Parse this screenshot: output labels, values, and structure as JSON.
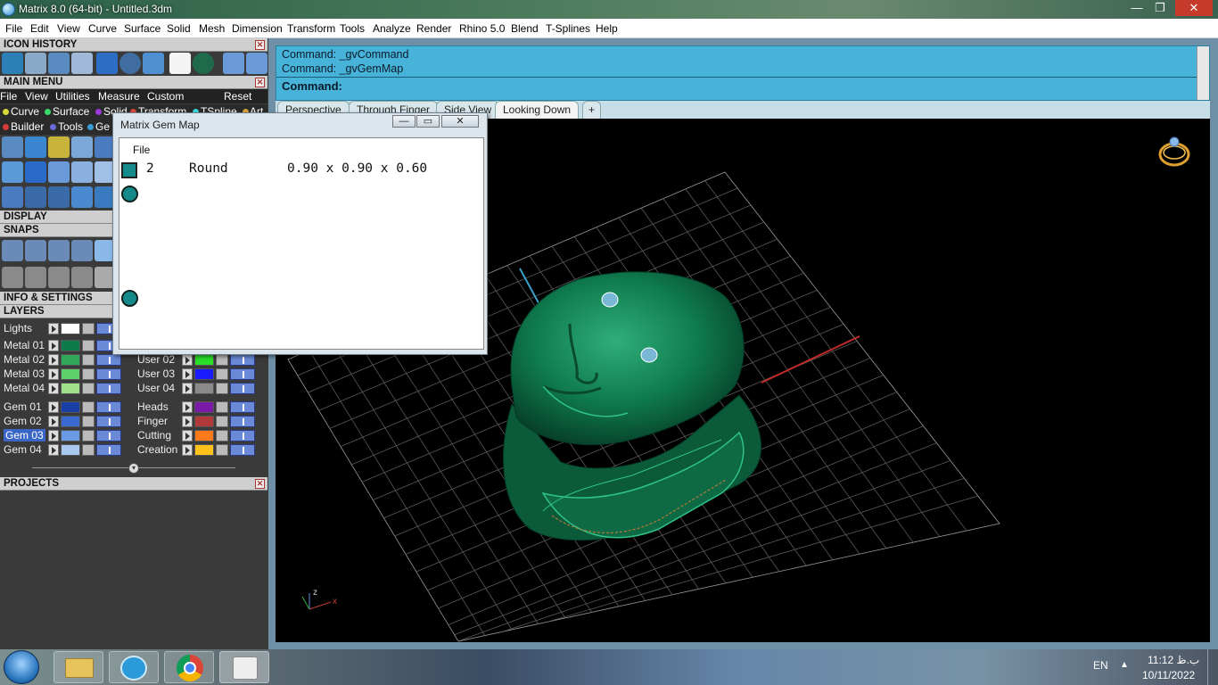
{
  "window": {
    "title": "Matrix 8.0 (64-bit) - Untitled.3dm",
    "minimize": "—",
    "restore": "❐",
    "close": "✕"
  },
  "menubar": [
    "File",
    "Edit",
    "View",
    "Curve",
    "Surface",
    "Solid",
    "Mesh",
    "Dimension",
    "Transform",
    "Tools",
    "Analyze",
    "Render",
    "Rhino 5.0",
    "Blend",
    "T-Splines",
    "Help"
  ],
  "left_panel": {
    "icon_history": "ICON HISTORY",
    "main_menu": "MAIN MENU",
    "main_menu_items": [
      "File",
      "View",
      "Utilities",
      "Measure",
      "Custom",
      "Reset"
    ],
    "tag_row1": [
      "Curve",
      "Surface",
      "Solid",
      "Transform",
      "TSpline",
      "Art"
    ],
    "tag_row2": [
      "Builder",
      "Tools",
      "Ge"
    ],
    "display": "DISPLAY",
    "snaps": "SNAPS",
    "info_settings": "INFO & SETTINGS",
    "layers": "LAYERS",
    "projects": "PROJECTS",
    "layers_left": [
      {
        "name": "Lights",
        "color": "#ffffff"
      },
      {
        "name": "Metal 01",
        "color": "#0f7a4a"
      },
      {
        "name": "Metal 02",
        "color": "#2fa65a"
      },
      {
        "name": "Metal 03",
        "color": "#5fd06a"
      },
      {
        "name": "Metal 04",
        "color": "#a0e08a"
      },
      {
        "name": "Gem 01",
        "color": "#1a3fa6"
      },
      {
        "name": "Gem 02",
        "color": "#3a6ad0"
      },
      {
        "name": "Gem 03",
        "color": "#6a9ae6"
      },
      {
        "name": "Gem 04",
        "color": "#a8c8f0"
      }
    ],
    "layers_right": [
      {
        "name": "User 02",
        "color": "#2adf2a"
      },
      {
        "name": "User 03",
        "color": "#1a1aff"
      },
      {
        "name": "User 04",
        "color": "#8a8a8a"
      },
      {
        "name": "Heads",
        "color": "#7a1aa6"
      },
      {
        "name": "Finger",
        "color": "#b03a3a"
      },
      {
        "name": "Cutting",
        "color": "#ff7a1a"
      },
      {
        "name": "Creation",
        "color": "#ffc21a"
      }
    ]
  },
  "command": {
    "line1": "Command: _gvCommand",
    "line2": "Command: _gvGemMap",
    "prompt": "Command:"
  },
  "viewport_tabs": [
    "Perspective",
    "Through Finger",
    "Side View",
    "Looking Down"
  ],
  "add_tab": "+",
  "gem_map": {
    "title": "Matrix Gem Map",
    "menu_file": "File",
    "row": {
      "count": "2",
      "shape": "Round",
      "size": "0.90 x 0.90 x 0.60"
    },
    "swatch_color": "#158a8a"
  },
  "viewport": {
    "axis_x": "x",
    "axis_z": "z",
    "background": "#000000",
    "ring_color": "#0f6b48"
  },
  "taskbar": {
    "language": "EN",
    "time": "11:12 ب.ظ",
    "date": "10/11/2022"
  }
}
